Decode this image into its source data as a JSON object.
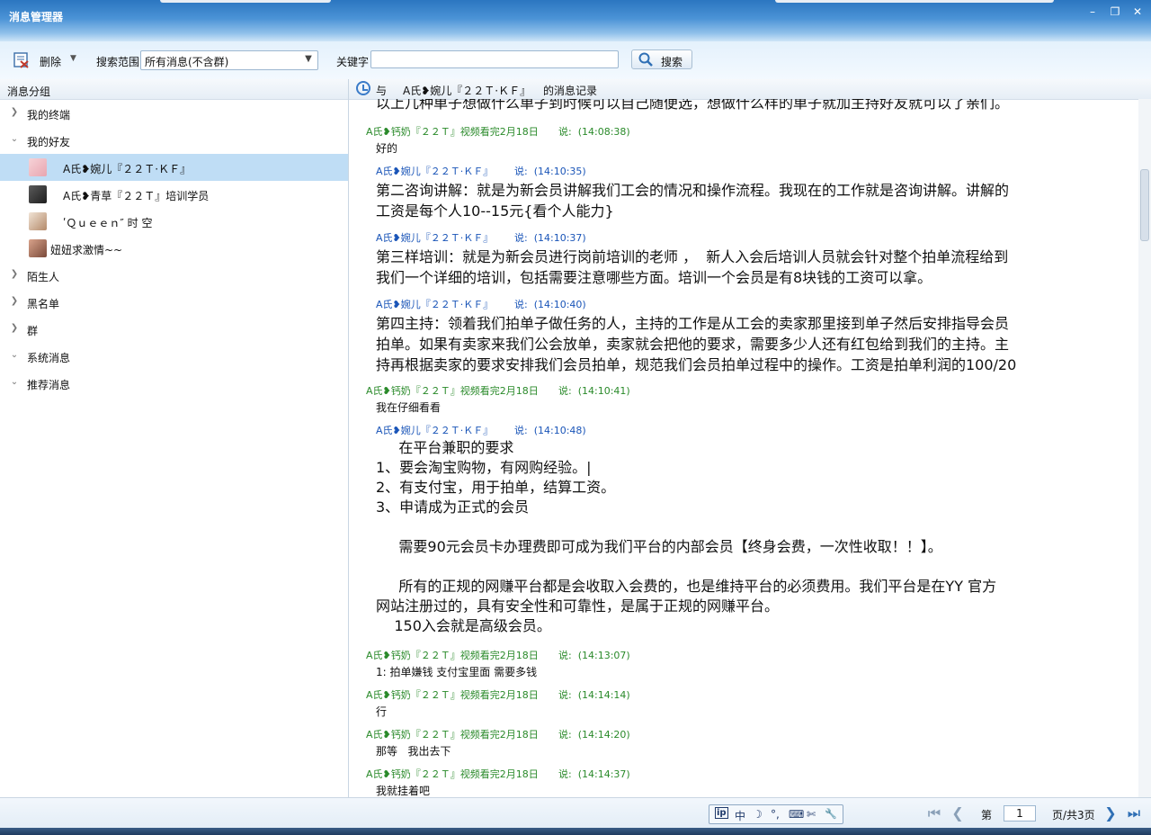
{
  "window": {
    "title": "消息管理器",
    "minimize": "–",
    "restore": "❐",
    "close": "✕"
  },
  "toolbar": {
    "delete_label": "删除",
    "scope_label": "搜索范围",
    "scope_value": "所有消息(不含群)",
    "keyword_label": "关键字",
    "keyword_value": "",
    "search_label": "搜索"
  },
  "sidebar": {
    "header": "消息分组",
    "groups": [
      {
        "label": "我的终端",
        "expanded": false
      },
      {
        "label": "我的好友",
        "expanded": true
      },
      {
        "label": "陌生人",
        "expanded": false
      },
      {
        "label": "黑名单",
        "expanded": false
      },
      {
        "label": "群",
        "expanded": false
      },
      {
        "label": "系统消息",
        "expanded": true
      },
      {
        "label": "推荐消息",
        "expanded": true
      }
    ],
    "friends": [
      {
        "name": "A氏❥婉儿『２２Ｔ·ＫＦ』",
        "selected": true
      },
      {
        "name": "A氏❥青草『２２Ｔ』培训学员",
        "selected": false
      },
      {
        "name": "ʹＱｕｅｅｎ″ 时 空",
        "selected": false
      },
      {
        "name": "妞妞求激情~~",
        "selected": false
      }
    ]
  },
  "history": {
    "header_prefix": "与",
    "contact": "A氏❥婉儿『２２Ｔ·ＫＦ』",
    "header_suffix": "的消息记录",
    "cut_line": "以上几种单子想做什么单子到时候可以自己随便选，想做什么样的单子就加主持好友就可以了亲们。",
    "messages": [
      {
        "sender": "A氏❥钙奶『２２Ｔ』视频看完2月18日",
        "time": "说:  (14:08:38)",
        "text": "好的"
      },
      {
        "sender": "A氏❥婉儿『２２Ｔ·ＫＦ』",
        "time": "说:  (14:10:35)",
        "text": "第二咨询讲解：就是为新会员讲解我们工会的情况和操作流程。我现在的工作就是咨询讲解。讲解的\n工资是每个人10--15元{看个人能力}"
      },
      {
        "sender": "A氏❥婉儿『２２Ｔ·ＫＦ』",
        "time": "说:  (14:10:37)",
        "text": "第三样培训：就是为新会员进行岗前培训的老师 ，  新人入会后培训人员就会针对整个拍单流程给到\n我们一个详细的培训，包括需要注意哪些方面。培训一个会员是有8块钱的工资可以拿。"
      },
      {
        "sender": "A氏❥婉儿『２２Ｔ·ＫＦ』",
        "time": "说:  (14:10:40)",
        "text": "第四主持：领着我们拍单子做任务的人，主持的工作是从工会的卖家那里接到单子然后安排指导会员\n拍单。如果有卖家来我们公会放单，卖家就会把他的要求，需要多少人还有红包给到我们的主持。主\n持再根据卖家的要求安排我们会员拍单，规范我们会员拍单过程中的操作。工资是拍单利润的100/20"
      },
      {
        "sender": "A氏❥钙奶『２２Ｔ』视频看完2月18日",
        "time": "说:  (14:10:41)",
        "text": "我在仔细看看"
      },
      {
        "sender": "A氏❥婉儿『２２Ｔ·ＫＦ』",
        "time": "说:  (14:10:48)",
        "text": "     在平台兼职的要求\n1、要会淘宝购物，有网购经验。|\n2、有支付宝，用于拍单，结算工资。\n3、申请成为正式的会员\n\n     需要90元会员卡办理费即可成为我们平台的内部会员【终身会费，一次性收取！！】。\n\n     所有的正规的网赚平台都是会收取入会费的，也是维持平台的必须费用。我们平台是在YY 官方\n网站注册过的，具有安全性和可靠性，是属于正规的网赚平台。\n    150入会就是高级会员。"
      },
      {
        "sender": "A氏❥钙奶『２２Ｔ』视频看完2月18日",
        "time": "说:  (14:13:07)",
        "text": "1: 拍单嫌钱 支付宝里面 需要多钱"
      },
      {
        "sender": "A氏❥钙奶『２２Ｔ』视频看完2月18日",
        "time": "说:  (14:14:14)",
        "text": "行"
      },
      {
        "sender": "A氏❥钙奶『２２Ｔ』视频看完2月18日",
        "time": "说:  (14:14:20)",
        "text": "那等   我出去下"
      },
      {
        "sender": "A氏❥钙奶『２２Ｔ』视频看完2月18日",
        "time": "说:  (14:14:37)",
        "text": "我就挂着吧"
      }
    ]
  },
  "status": {
    "ime_items": [
      "中",
      "☽",
      "°,",
      "⌨",
      "✄",
      "🔧"
    ],
    "page_prefix": "第",
    "page_value": "1",
    "page_suffix": "页/共3页"
  },
  "colors": {
    "titlebar": "#2b76c0",
    "selected_row": "#bfddf5",
    "meta_green": "#2a8a2a",
    "meta_blue": "#1a55b8"
  }
}
